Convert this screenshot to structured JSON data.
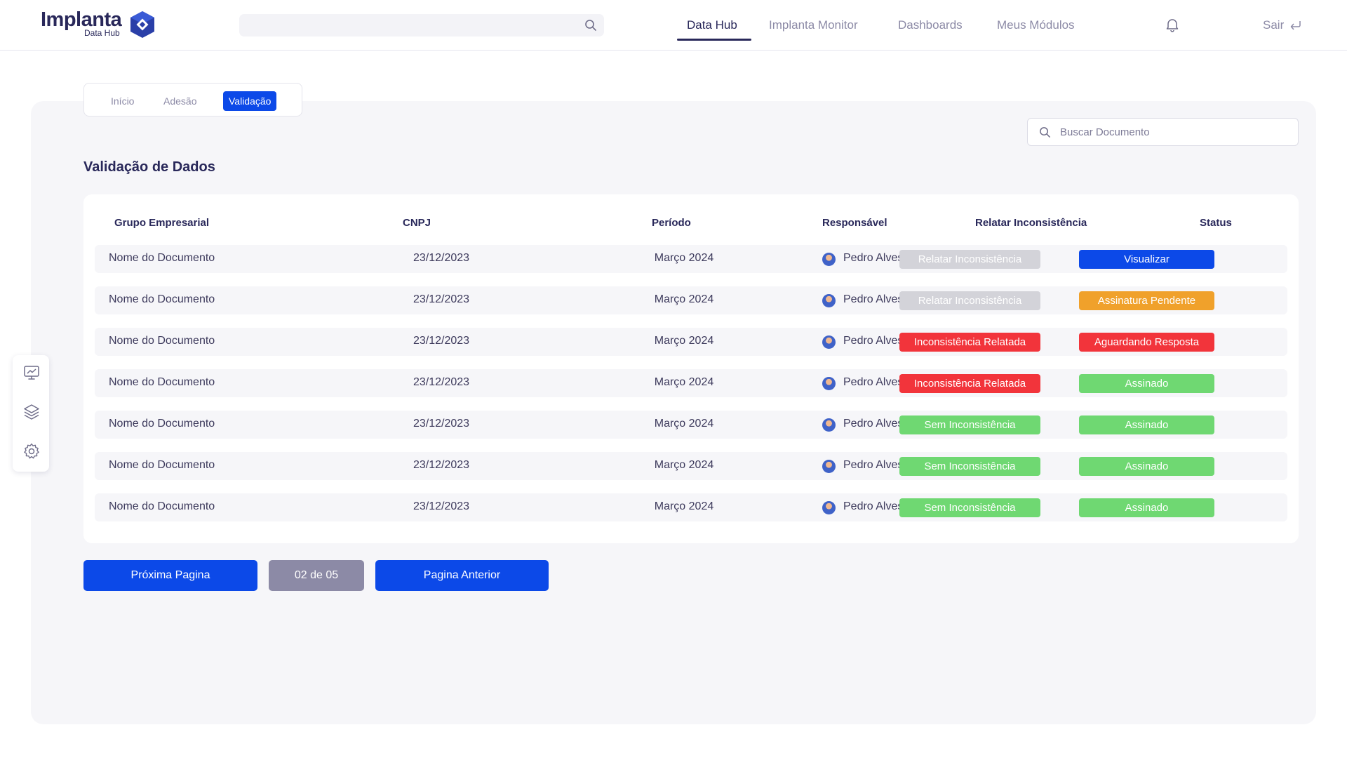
{
  "brand": {
    "name": "Implanta",
    "sub": "Data Hub"
  },
  "top_search": {
    "placeholder": ""
  },
  "nav": {
    "items": [
      "Data Hub",
      "Implanta Monitor",
      "Dashboards",
      "Meus Módulos"
    ],
    "active": "Data Hub",
    "logout_label": "Sair"
  },
  "subtabs": {
    "items": [
      "Início",
      "Adesão",
      "Validação"
    ],
    "active": "Validação"
  },
  "doc_search": {
    "placeholder": "Buscar Documento"
  },
  "page_title": "Validação de Dados",
  "table": {
    "headers": [
      "Grupo Empresarial",
      "CNPJ",
      "Período",
      "Responsável",
      "Relatar Inconsistência",
      "Status"
    ],
    "rows": [
      {
        "grupo": "Nome do Documento",
        "cnpj": "23/12/2023",
        "periodo": "Março 2024",
        "responsavel": "Pedro Alves",
        "relatar": "Relatar Inconsistência",
        "relatar_color": "#d3d3d9",
        "status": "Visualizar",
        "status_color": "#0c49e8"
      },
      {
        "grupo": "Nome do Documento",
        "cnpj": "23/12/2023",
        "periodo": "Março 2024",
        "responsavel": "Pedro Alves",
        "relatar": "Relatar Inconsistência",
        "relatar_color": "#d3d3d9",
        "status": "Assinatura Pendente",
        "status_color": "#f0a12b"
      },
      {
        "grupo": "Nome do Documento",
        "cnpj": "23/12/2023",
        "periodo": "Março 2024",
        "responsavel": "Pedro Alves",
        "relatar": "Inconsistência Relatada",
        "relatar_color": "#f2343b",
        "status": "Aguardando Resposta",
        "status_color": "#f2343b"
      },
      {
        "grupo": "Nome do Documento",
        "cnpj": "23/12/2023",
        "periodo": "Março 2024",
        "responsavel": "Pedro Alves",
        "relatar": "Inconsistência Relatada",
        "relatar_color": "#f2343b",
        "status": "Assinado",
        "status_color": "#6fd872"
      },
      {
        "grupo": "Nome do Documento",
        "cnpj": "23/12/2023",
        "periodo": "Março 2024",
        "responsavel": "Pedro Alves",
        "relatar": "Sem Inconsistência",
        "relatar_color": "#6fd872",
        "status": "Assinado",
        "status_color": "#6fd872"
      },
      {
        "grupo": "Nome do Documento",
        "cnpj": "23/12/2023",
        "periodo": "Março 2024",
        "responsavel": "Pedro Alves",
        "relatar": "Sem Inconsistência",
        "relatar_color": "#6fd872",
        "status": "Assinado",
        "status_color": "#6fd872"
      },
      {
        "grupo": "Nome do Documento",
        "cnpj": "23/12/2023",
        "periodo": "Março 2024",
        "responsavel": "Pedro Alves",
        "relatar": "Sem Inconsistência",
        "relatar_color": "#6fd872",
        "status": "Assinado",
        "status_color": "#6fd872"
      }
    ]
  },
  "pagination": {
    "next_label": "Próxima Pagina",
    "page_indicator": "02 de 05",
    "prev_label": "Pagina Anterior"
  },
  "side_dock": {
    "icons": [
      "monitor-chart-icon",
      "layers-icon",
      "gear-icon"
    ]
  },
  "colors": {
    "accent": "#0c49e8",
    "brand_dark": "#29285a",
    "panel_bg": "#f6f6f9",
    "indicator_gray": "#8c8aa6"
  }
}
